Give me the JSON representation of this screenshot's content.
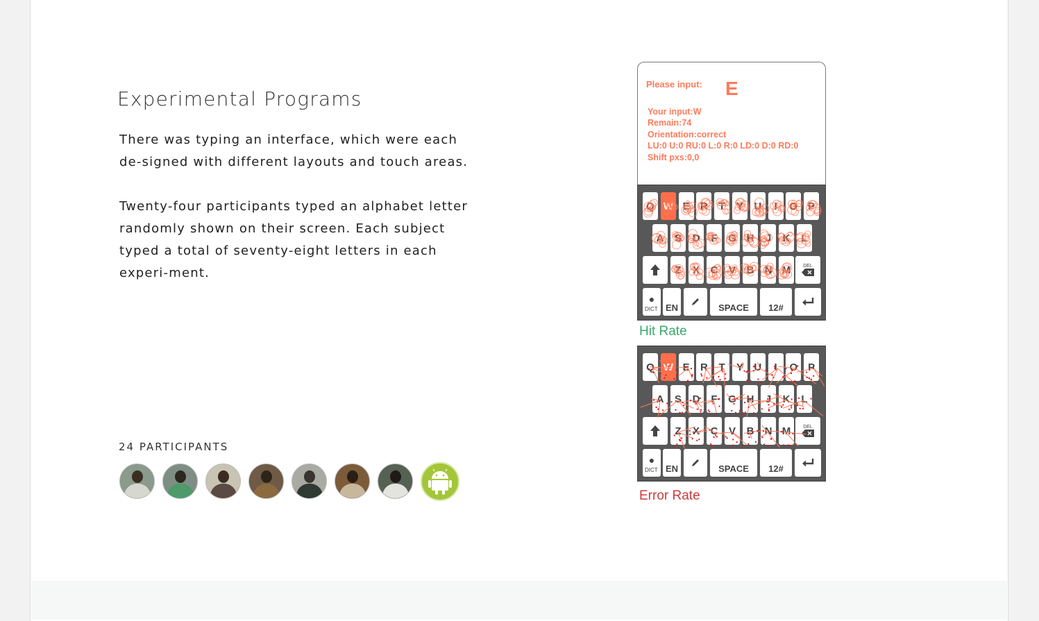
{
  "section": {
    "title": "Experimental Programs",
    "paragraph1": "There was typing an interface, which were each de-signed with different layouts and touch areas.",
    "paragraph2": "Twenty-four participants typed an alphabet letter randomly shown on their screen. Each subject typed a total of seventy-eight letters in each experi-ment."
  },
  "participants": {
    "label": "24 PARTICIPANTS",
    "avatars": [
      "participant-photo",
      "participant-photo",
      "participant-photo",
      "participant-photo",
      "participant-photo",
      "participant-photo",
      "participant-photo",
      "android-icon"
    ]
  },
  "app_screen": {
    "prompt_label": "Please input:",
    "prompt_letter": "E",
    "status_lines": [
      "Your input:W",
      "Remain:74",
      "Orientation:correct",
      "LU:0 U:0 RU:0 L:0 R:0 LD:0 D:0 RD:0",
      "Shift pxs:0,0"
    ]
  },
  "keyboard": {
    "row1": [
      "Q",
      "W",
      "E",
      "R",
      "T",
      "Y",
      "U",
      "I",
      "O",
      "P"
    ],
    "row2": [
      "A",
      "S",
      "D",
      "F",
      "G",
      "H",
      "J",
      "K",
      "L"
    ],
    "row3": [
      "Z",
      "X",
      "C",
      "V",
      "B",
      "N",
      "M"
    ],
    "highlighted_key": "W",
    "del_label": "DEL",
    "dict_label": "DICT",
    "lang_label": "EN",
    "space_label": "SPACE",
    "num_label": "12#"
  },
  "captions": {
    "hit_rate": "Hit Rate",
    "error_rate": "Error Rate"
  },
  "colors": {
    "accent": "#ff6e4a",
    "hit": "#3aa86b",
    "error": "#cc3b3b",
    "android": "#a4c639"
  }
}
